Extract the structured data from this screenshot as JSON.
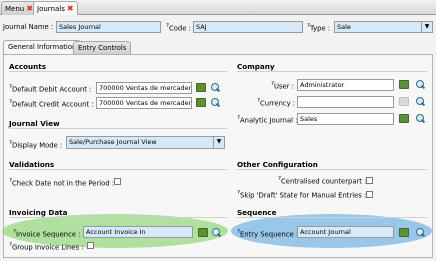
{
  "tabs": {
    "menu": "Menu",
    "journals": "Journals"
  },
  "header": {
    "journal_name_label": "Journal Name :",
    "journal_name_value": "Sales Journal",
    "code_label": "Code :",
    "code_value": "SAJ",
    "type_label": "Type :",
    "type_value": "Sale"
  },
  "subtabs": {
    "general": "General Information",
    "entry": "Entry Controls"
  },
  "accounts": {
    "title": "Accounts",
    "default_debit_label": "Default Debit Account :",
    "default_debit_value": "700000 Ventas de mercaderí",
    "default_credit_label": "Default Credit Account :",
    "default_credit_value": "700000 Ventas de mercaderí"
  },
  "company": {
    "title": "Company",
    "user_label": "User :",
    "user_value": "Administrator",
    "currency_label": "Currency :",
    "currency_value": "",
    "analytic_label": "Analytic Journal :",
    "analytic_value": "Sales"
  },
  "journal_view": {
    "title": "Journal View",
    "display_mode_label": "Display Mode :",
    "display_mode_value": "Sale/Purchase Journal View"
  },
  "validations": {
    "title": "Validations",
    "check_date_label": "Check Date not in the Period :"
  },
  "other": {
    "title": "Other Configuration",
    "centralised_label": "Centralised counterpart :",
    "skip_draft_label": "Skip 'Draft' State for Manual Entries :"
  },
  "invoicing": {
    "title": "Invoicing Data",
    "invoice_seq_label": "Invoice Sequence :",
    "invoice_seq_value": "Account Invoice In",
    "group_lines_label": "Group Invoice Lines :"
  },
  "sequence": {
    "title": "Sequence",
    "entry_seq_label": "Entry Sequence :",
    "entry_seq_value": "Account Journal"
  },
  "symbols": {
    "close": "✖",
    "help": "?",
    "arrow": "▼"
  },
  "colors": {
    "required_field": "#d6e9f9",
    "highlight_green": "#92d676",
    "highlight_blue": "#70b2e2",
    "folder_icon": "#5c8f38"
  }
}
